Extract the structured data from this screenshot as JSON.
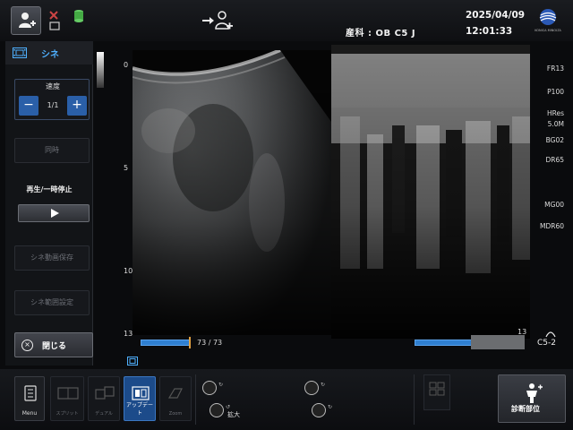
{
  "header": {
    "exam_info": "産科 : OB C5 J",
    "date": "2025/04/09",
    "time": "12:01:33",
    "logo_text": "KONICA MINOLTA"
  },
  "cine_panel": {
    "title": "シネ",
    "speed_label": "速度",
    "speed_value": "1/1",
    "speed_minus": "−",
    "speed_plus": "+",
    "sync_label": "同時",
    "play_pause_label": "再生/一時停止",
    "save_cine_label": "シネ動画保存",
    "range_label": "シネ範囲設定",
    "close_label": "閉じる"
  },
  "depth_scale": {
    "labels": [
      "0",
      "5",
      "10",
      "13"
    ]
  },
  "right_params": {
    "fr": "FR13",
    "power": "P100",
    "hres": "HRes",
    "freq": "5.0M",
    "bg": "BG02",
    "dr": "DR65",
    "mg": "MG00",
    "mdr": "MDR60"
  },
  "cine_status": {
    "frame_counter": "73 / 73",
    "b_progress_fraction": 1.0,
    "probe": "C5-2"
  },
  "right_depth_label": "13",
  "toolbar": {
    "menu_label": "Menu",
    "split_label": "スプリット",
    "dual_label": "デュアル",
    "update_label": "アップデート",
    "zoom_tool_label": "Zoom",
    "zoom_label": "拡大",
    "diag_label": "診断部位"
  },
  "colors": {
    "accent_blue": "#2f7fd0",
    "cine_title": "#4fb0ff",
    "active_button": "#1c4b8a"
  }
}
